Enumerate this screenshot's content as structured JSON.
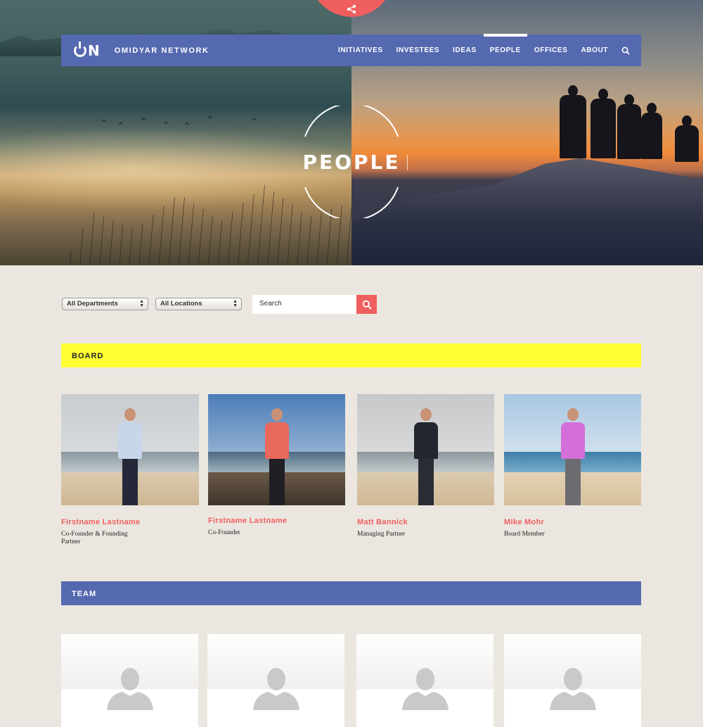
{
  "nav": {
    "logo_mark": "N",
    "logo_text": "OMIDYAR NETWORK",
    "links": [
      {
        "label": "INITIATIVES"
      },
      {
        "label": "INVESTEES"
      },
      {
        "label": "IDEAS"
      },
      {
        "label": "PEOPLE",
        "active": true
      },
      {
        "label": "OFFICES"
      },
      {
        "label": "ABOUT"
      }
    ],
    "search_icon": "search-icon"
  },
  "hero": {
    "title": "PEOPLE",
    "share_icon": "share-icon"
  },
  "filters": {
    "department": "All Departments",
    "location": "All Locations",
    "search_placeholder": "Search"
  },
  "board": {
    "heading": "BOARD",
    "members": [
      {
        "name": "Firstname Lastname",
        "title": "Co-Founder & Founding Partner"
      },
      {
        "name": "Firstname Lastname",
        "title": "Co-Founder"
      },
      {
        "name": "Matt Bannick",
        "title": "Managing Partner"
      },
      {
        "name": "Mike Mohr",
        "title": "Board Member"
      }
    ]
  },
  "team": {
    "heading": "TEAM",
    "placeholder_icon": "avatar-placeholder-icon"
  },
  "colors": {
    "brand_blue": "#5569b0",
    "accent_red": "#ef5f5f",
    "board_yellow": "#ffff33",
    "page_bg": "#ebe7e0"
  }
}
